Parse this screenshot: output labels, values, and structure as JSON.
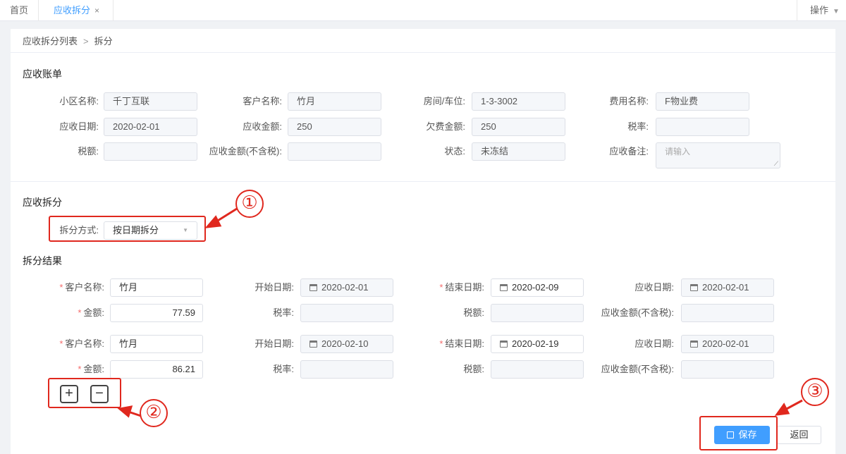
{
  "tabs": {
    "home": "首页",
    "active": "应收拆分",
    "close": "×",
    "operations": "操作"
  },
  "breadcrumb": {
    "parent": "应收拆分列表",
    "separator": ">",
    "current": "拆分"
  },
  "bill": {
    "title": "应收账单",
    "community_label": "小区名称:",
    "community": "千丁互联",
    "customer_label": "客户名称:",
    "customer": "竹月",
    "room_label": "房间/车位:",
    "room": "1-3-3002",
    "fee_label": "费用名称:",
    "fee": "F物业费",
    "receivable_date_label": "应收日期:",
    "receivable_date": "2020-02-01",
    "receivable_amount_label": "应收金额:",
    "receivable_amount": "250",
    "arrears_label": "欠费金额:",
    "arrears": "250",
    "tax_rate_label": "税率:",
    "tax_rate": "",
    "tax_label": "税额:",
    "tax": "",
    "amount_ex_tax_label": "应收金额(不含税):",
    "amount_ex_tax": "",
    "status_label": "状态:",
    "status": "未冻结",
    "remark_label": "应收备注:",
    "remark_placeholder": "请输入"
  },
  "split": {
    "title": "应收拆分",
    "method_label": "拆分方式:",
    "method": "按日期拆分"
  },
  "results": {
    "title": "拆分结果",
    "labels": {
      "customer": "客户名称:",
      "start": "开始日期:",
      "end": "结束日期:",
      "receivable_date": "应收日期:",
      "amount": "金额:",
      "tax_rate": "税率:",
      "tax": "税额:",
      "amount_ex_tax": "应收金额(不含税):"
    },
    "rows": [
      {
        "customer": "竹月",
        "start": "2020-02-01",
        "end": "2020-02-09",
        "receivable_date": "2020-02-01",
        "amount": "77.59",
        "tax_rate": "",
        "tax": "",
        "amount_ex_tax": ""
      },
      {
        "customer": "竹月",
        "start": "2020-02-10",
        "end": "2020-02-19",
        "receivable_date": "2020-02-01",
        "amount": "86.21",
        "tax_rate": "",
        "tax": "",
        "amount_ex_tax": ""
      }
    ],
    "add": "+",
    "remove": "−"
  },
  "actions": {
    "save": "保存",
    "back": "返回"
  },
  "annotations": {
    "m1": "①",
    "m2": "②",
    "m3": "③"
  },
  "colors": {
    "primary": "#409eff",
    "required": "#f56c6c",
    "annotation": "#e0281e"
  }
}
